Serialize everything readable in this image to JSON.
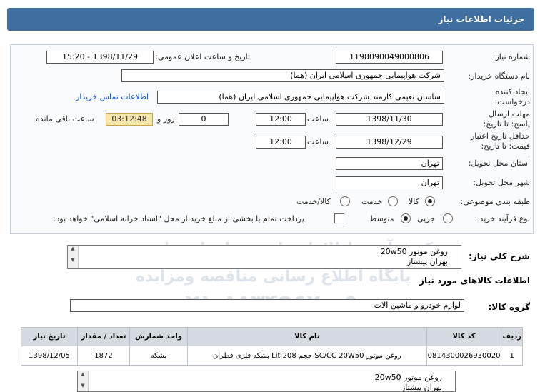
{
  "header": {
    "title": "جزئیات اطلاعات نیاز"
  },
  "fields": {
    "need_number_label": "شماره نیاز:",
    "need_number": "1198090049000806",
    "announce_label": "تاریخ و ساعت اعلان عمومی:",
    "announce_value": "1398/11/29 - 15:20",
    "buyer_label": "نام دستگاه خریدار:",
    "buyer_value": "شرکت هواپیمایی جمهوری اسلامی ایران (هما)",
    "creator_label": "ایجاد کننده درخواست:",
    "creator_value": "ساسان نعیمی کارمند شرکت هواپیمایی جمهوری اسلامی ایران (هما)",
    "contact_link": "اطلاعات تماس خریدار",
    "deadline_label": "مهلت ارسال پاسخ: تا تاریخ:",
    "deadline_date": "1398/11/30",
    "time_label": "ساعت",
    "deadline_time": "12:00",
    "days_value": "0",
    "days_label": "روز و",
    "remaining_time": "03:12:48",
    "remaining_label": "ساعت باقی مانده",
    "validity_label": "حداقل تاریخ اعتبار قیمت: تا تاریخ:",
    "validity_date": "1398/12/29",
    "validity_time": "12:00",
    "province_label": "استان محل تحویل:",
    "province_value": "تهران",
    "city_label": "شهر محل تحویل:",
    "city_value": "تهران",
    "category_label": "طبقه بندی موضوعی:",
    "category_options": [
      "کالا",
      "خدمت",
      "کالا/خدمت"
    ],
    "category_selected": "کالا",
    "process_label": "نوع فرآیند خرید :",
    "process_options": [
      "جزیی",
      "متوسط"
    ],
    "process_selected": "متوسط",
    "payment_note": "پرداخت تمام یا بخشی از مبلغ خرید،از محل \"اسناد خزانه اسلامی\" خواهد بود."
  },
  "description": {
    "label": "شرح کلی نیاز:",
    "lines": [
      "روغن موتور 20w50",
      "بهران پیشتاز"
    ]
  },
  "goods": {
    "section_title": "اطلاعات کالاهای مورد نیاز",
    "group_label": "گروه کالا:",
    "group_value": "لوازم خودرو و ماشین آلات",
    "columns": [
      "ردیف",
      "کد کالا",
      "نام کالا",
      "واحد شمارش",
      "تعداد / مقدار",
      "تاریخ نیاز"
    ],
    "rows": [
      [
        "1",
        "0814300026930020",
        "روغن موتور SC/CC 20W50 حجم 208 Lit بشکه فلزی قطران",
        "بشکه",
        "1872",
        "1398/12/05"
      ]
    ],
    "notes_lines": [
      "روغن موتور 20w50",
      "بهران پیشتاز"
    ]
  },
  "watermark": {
    "line1": "مرکز فرآوری اطلاعات پارس نماد داده ها",
    "line2": "پایگاه اطلاع رسانی مناقصه ومزایده",
    "phone": "۰۲۱-۸۸۳۴۹۶۷۰-۵"
  },
  "colors": {
    "header_bg": "#3e6fa0",
    "link": "#1a56c9",
    "remaining_bg": "#f4e7a9"
  }
}
